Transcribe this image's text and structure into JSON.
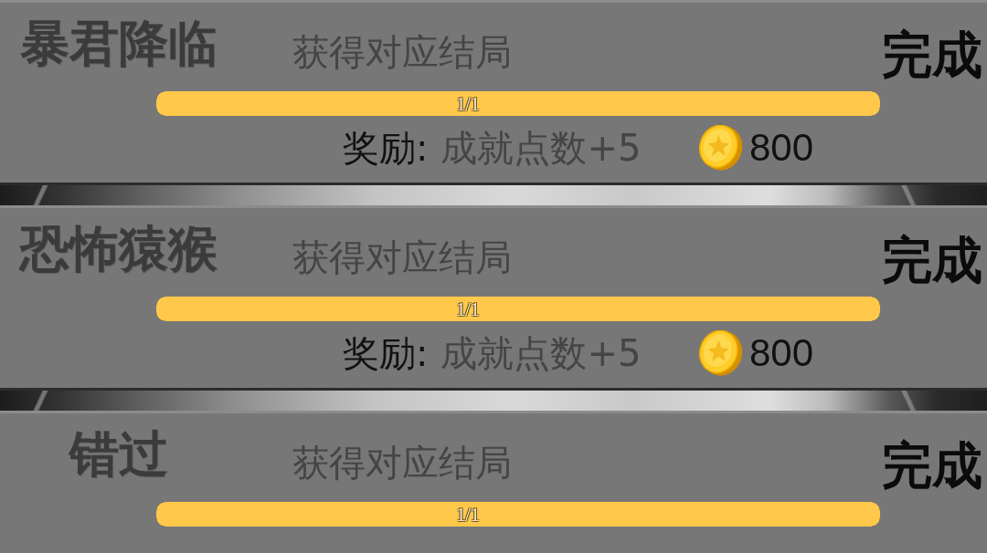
{
  "achievements": [
    {
      "title": "暴君降临",
      "description": "获得对应结局",
      "status": "完成",
      "progress": {
        "level": 1,
        "text": "1/1"
      },
      "reward": {
        "label": "奖励:",
        "value": "成就点数+5",
        "coins": "800"
      }
    },
    {
      "title": "恐怖猿猴",
      "description": "获得对应结局",
      "status": "完成",
      "progress": {
        "level": 1,
        "text": "1/1"
      },
      "reward": {
        "label": "奖励:",
        "value": "成就点数+5",
        "coins": "800"
      }
    },
    {
      "title": "错过",
      "description": "获得对应结局",
      "status": "完成",
      "progress": {
        "level": 1,
        "text": "1/1"
      }
    }
  ]
}
